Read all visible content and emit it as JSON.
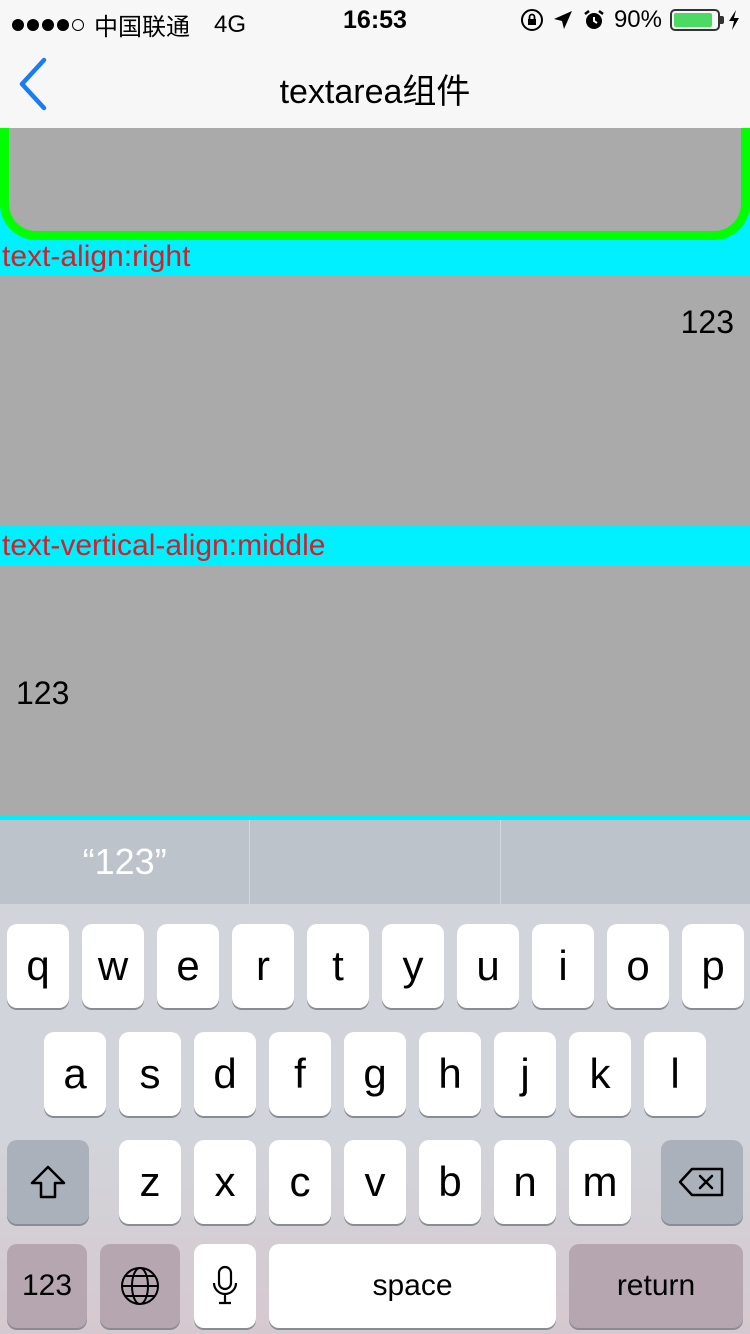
{
  "status_bar": {
    "carrier": "中国联通",
    "network": "4G",
    "time": "16:53",
    "battery_pct": "90%",
    "battery_level": 0.9,
    "icons": [
      "orientation-lock-icon",
      "location-arrow-icon",
      "alarm-icon",
      "charging-icon"
    ]
  },
  "nav": {
    "title": "textarea组件",
    "back_icon": "chevron-left-icon"
  },
  "content": {
    "label_right": "text-align:right",
    "textarea_right_value": "123",
    "label_middle": "text-vertical-align:middle",
    "textarea_middle_value": "123",
    "colors": {
      "accent_green": "#00ff00",
      "cyan": "#00f0ff",
      "label_red": "#d0212f",
      "textarea_bg": "#aaaaaa"
    }
  },
  "keyboard": {
    "suggestions": [
      "“123”",
      "",
      ""
    ],
    "row1": [
      "q",
      "w",
      "e",
      "r",
      "t",
      "y",
      "u",
      "i",
      "o",
      "p"
    ],
    "row2": [
      "a",
      "s",
      "d",
      "f",
      "g",
      "h",
      "j",
      "k",
      "l"
    ],
    "row3": [
      "z",
      "x",
      "c",
      "v",
      "b",
      "n",
      "m"
    ],
    "numbers_label": "123",
    "space_label": "space",
    "return_label": "return",
    "icons": {
      "shift": "shift-icon",
      "delete": "delete-icon",
      "globe": "globe-icon",
      "mic": "microphone-icon"
    }
  }
}
